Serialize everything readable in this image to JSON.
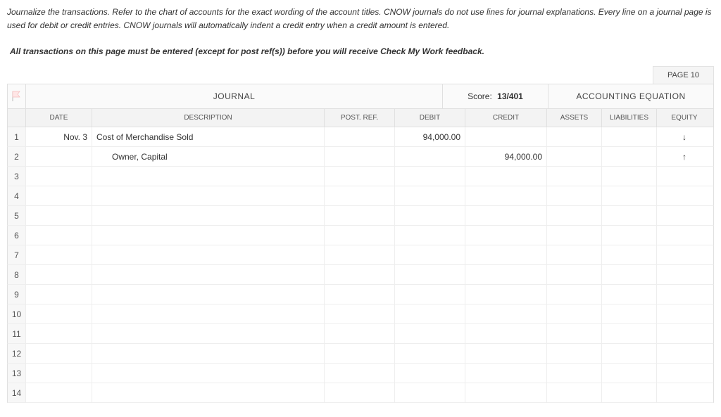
{
  "instructions": "Journalize the transactions. Refer to the chart of accounts for the exact wording of the account titles. CNOW journals do not use lines for journal explanations. Every line on a journal page is used for debit or credit entries. CNOW journals will automatically indent a credit entry when a credit amount is entered.",
  "feedback_note": "All transactions on this page must be entered (except for post ref(s)) before you will receive Check My Work feedback.",
  "page_label": "PAGE 10",
  "header": {
    "journal_title": "JOURNAL",
    "score_label": "Score:",
    "score_value": "13/401",
    "equation_title": "ACCOUNTING EQUATION"
  },
  "columns": {
    "date": "DATE",
    "description": "DESCRIPTION",
    "post_ref": "POST. REF.",
    "debit": "DEBIT",
    "credit": "CREDIT",
    "assets": "ASSETS",
    "liabilities": "LIABILITIES",
    "equity": "EQUITY"
  },
  "rows": [
    {
      "num": "1",
      "date": "Nov. 3",
      "description": "Cost of Merchandise Sold",
      "indent": false,
      "post_ref": "",
      "debit": "94,000.00",
      "credit": "",
      "assets": "",
      "liabilities": "",
      "equity": "↓"
    },
    {
      "num": "2",
      "date": "",
      "description": "Owner, Capital",
      "indent": true,
      "post_ref": "",
      "debit": "",
      "credit": "94,000.00",
      "assets": "",
      "liabilities": "",
      "equity": "↑"
    },
    {
      "num": "3",
      "date": "",
      "description": "",
      "indent": false,
      "post_ref": "",
      "debit": "",
      "credit": "",
      "assets": "",
      "liabilities": "",
      "equity": ""
    },
    {
      "num": "4",
      "date": "",
      "description": "",
      "indent": false,
      "post_ref": "",
      "debit": "",
      "credit": "",
      "assets": "",
      "liabilities": "",
      "equity": ""
    },
    {
      "num": "5",
      "date": "",
      "description": "",
      "indent": false,
      "post_ref": "",
      "debit": "",
      "credit": "",
      "assets": "",
      "liabilities": "",
      "equity": ""
    },
    {
      "num": "6",
      "date": "",
      "description": "",
      "indent": false,
      "post_ref": "",
      "debit": "",
      "credit": "",
      "assets": "",
      "liabilities": "",
      "equity": ""
    },
    {
      "num": "7",
      "date": "",
      "description": "",
      "indent": false,
      "post_ref": "",
      "debit": "",
      "credit": "",
      "assets": "",
      "liabilities": "",
      "equity": ""
    },
    {
      "num": "8",
      "date": "",
      "description": "",
      "indent": false,
      "post_ref": "",
      "debit": "",
      "credit": "",
      "assets": "",
      "liabilities": "",
      "equity": ""
    },
    {
      "num": "9",
      "date": "",
      "description": "",
      "indent": false,
      "post_ref": "",
      "debit": "",
      "credit": "",
      "assets": "",
      "liabilities": "",
      "equity": ""
    },
    {
      "num": "10",
      "date": "",
      "description": "",
      "indent": false,
      "post_ref": "",
      "debit": "",
      "credit": "",
      "assets": "",
      "liabilities": "",
      "equity": ""
    },
    {
      "num": "11",
      "date": "",
      "description": "",
      "indent": false,
      "post_ref": "",
      "debit": "",
      "credit": "",
      "assets": "",
      "liabilities": "",
      "equity": ""
    },
    {
      "num": "12",
      "date": "",
      "description": "",
      "indent": false,
      "post_ref": "",
      "debit": "",
      "credit": "",
      "assets": "",
      "liabilities": "",
      "equity": ""
    },
    {
      "num": "13",
      "date": "",
      "description": "",
      "indent": false,
      "post_ref": "",
      "debit": "",
      "credit": "",
      "assets": "",
      "liabilities": "",
      "equity": ""
    },
    {
      "num": "14",
      "date": "",
      "description": "",
      "indent": false,
      "post_ref": "",
      "debit": "",
      "credit": "",
      "assets": "",
      "liabilities": "",
      "equity": ""
    }
  ]
}
